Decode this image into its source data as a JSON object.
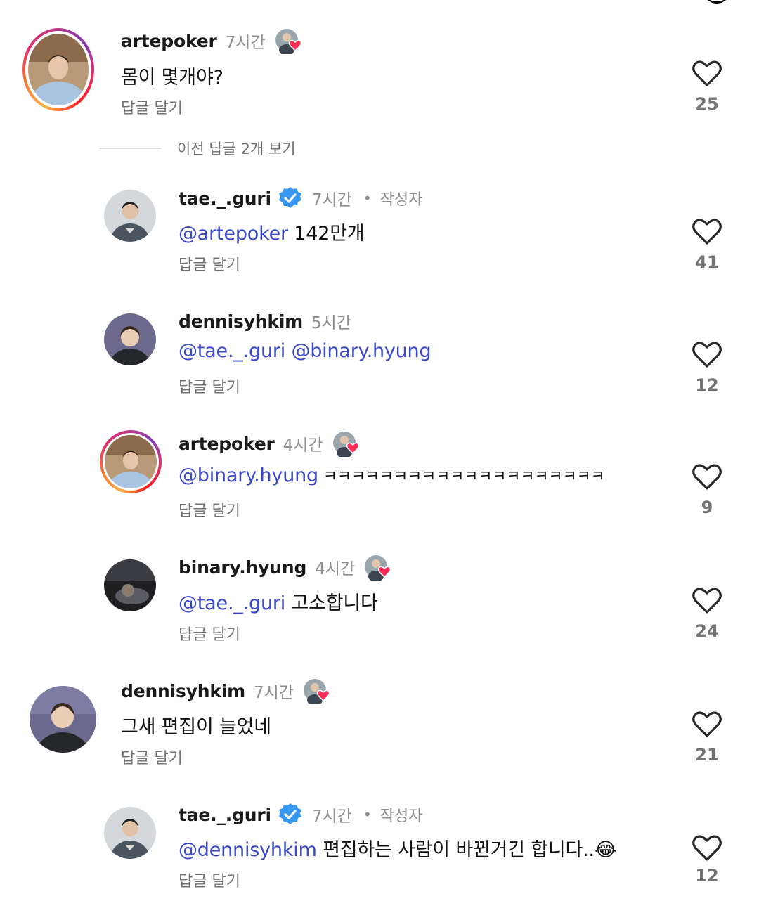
{
  "view_replies_label": "이전 답글 2개 보기",
  "reply_label": "답글 달기",
  "author_label": "작성자",
  "dot": "•",
  "colors": {
    "mention": "#3b49c9",
    "verified": "#3897f0",
    "heart_badge": "#ff2d55",
    "secondary_text": "#737373"
  },
  "comments": [
    {
      "username": "artepoker",
      "time": "7시간",
      "mention": "",
      "text": "몸이 몇개야?",
      "likes": "25"
    },
    {
      "username": "tae._.guri",
      "time": "7시간",
      "mention": "@artepoker",
      "text": " 142만개",
      "likes": "41"
    },
    {
      "username": "dennisyhkim",
      "time": "5시간",
      "mention": "@tae._.guri @binary.hyung",
      "text": "",
      "likes": "12"
    },
    {
      "username": "artepoker",
      "time": "4시간",
      "mention": "@binary.hyung",
      "text": " ㅋㅋㅋㅋㅋㅋㅋㅋㅋㅋㅋㅋㅋㅋㅋㅋㅋㅋㅋㅋ",
      "likes": "9"
    },
    {
      "username": "binary.hyung",
      "time": "4시간",
      "mention": "@tae._.guri",
      "text": " 고소합니다",
      "likes": "24"
    },
    {
      "username": "dennisyhkim",
      "time": "7시간",
      "mention": "",
      "text": "그새 편집이 늘었네",
      "likes": "21"
    },
    {
      "username": "tae._.guri",
      "time": "7시간",
      "mention": "@dennisyhkim",
      "text": " 편집하는 사람이 바뀐거긴 합니다..😂",
      "likes": "12"
    }
  ]
}
